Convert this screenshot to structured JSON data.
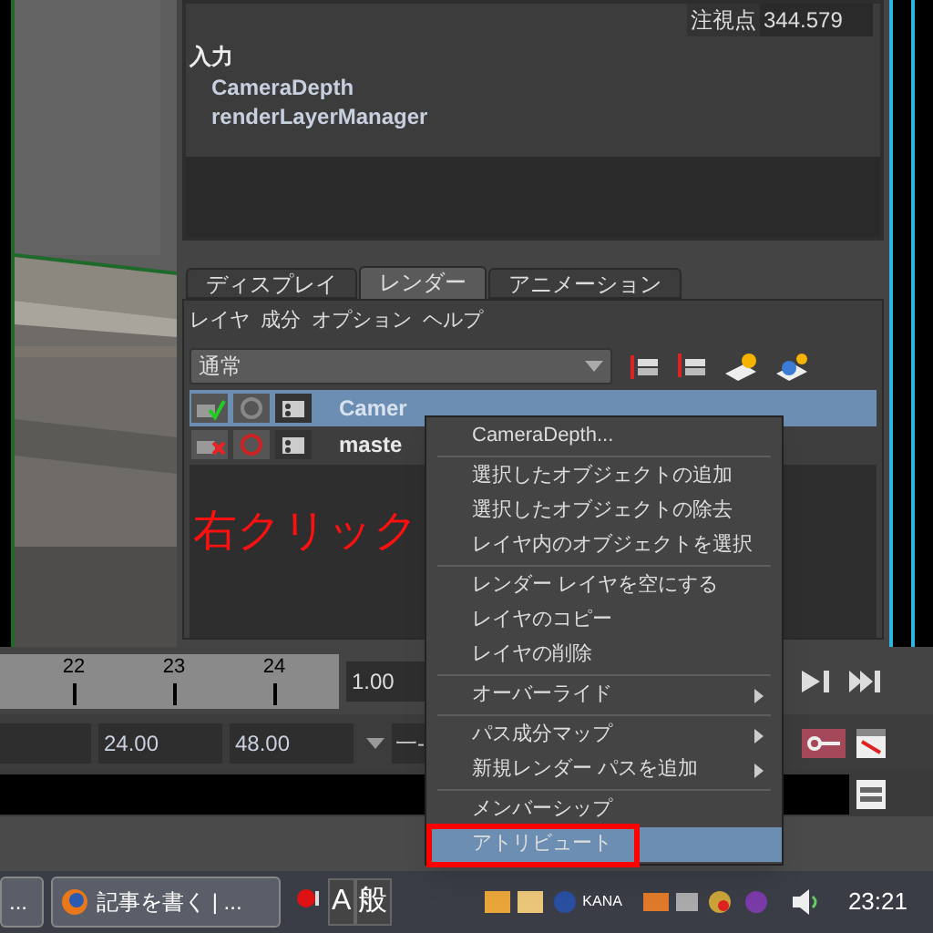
{
  "channel_box": {
    "look_at_label": "注視点",
    "look_at_value": "344.579",
    "inputs_heading": "入力",
    "inputs": [
      "CameraDepth",
      "renderLayerManager"
    ]
  },
  "tabs": [
    {
      "label": "ディスプレイ",
      "selected": false
    },
    {
      "label": "レンダー",
      "selected": true
    },
    {
      "label": "アニメーション",
      "selected": false
    }
  ],
  "layer_menu": [
    "レイヤ",
    "成分",
    "オプション",
    "ヘルプ"
  ],
  "blend_mode": "通常",
  "layers": [
    {
      "name": "Camer",
      "selected": true,
      "renderable": true
    },
    {
      "name": "maste",
      "selected": false,
      "renderable": false
    }
  ],
  "timeline": {
    "ticks": [
      "22",
      "23",
      "24"
    ],
    "current": "1.00"
  },
  "range": {
    "values": [
      "24.00",
      "48.00"
    ],
    "option": "一-"
  },
  "context_menu": [
    [
      {
        "label": "CameraDepth...",
        "submenu": false,
        "selected": false,
        "marked": false
      }
    ],
    [
      {
        "label": "選択したオブジェクトの追加",
        "submenu": false,
        "selected": false,
        "marked": false
      },
      {
        "label": "選択したオブジェクトの除去",
        "submenu": false,
        "selected": false,
        "marked": false
      },
      {
        "label": "レイヤ内のオブジェクトを選択",
        "submenu": false,
        "selected": false,
        "marked": false
      }
    ],
    [
      {
        "label": "レンダー レイヤを空にする",
        "submenu": false,
        "selected": false,
        "marked": false
      },
      {
        "label": "レイヤのコピー",
        "submenu": false,
        "selected": false,
        "marked": false
      },
      {
        "label": "レイヤの削除",
        "submenu": false,
        "selected": false,
        "marked": false
      }
    ],
    [
      {
        "label": "オーバーライド",
        "submenu": true,
        "selected": false,
        "marked": false
      }
    ],
    [
      {
        "label": "パス成分マップ",
        "submenu": true,
        "selected": false,
        "marked": false
      },
      {
        "label": "新規レンダー パスを追加",
        "submenu": true,
        "selected": false,
        "marked": false
      }
    ],
    [
      {
        "label": "メンバーシップ",
        "submenu": false,
        "selected": false,
        "marked": false
      },
      {
        "label": "アトリビュート",
        "submenu": false,
        "selected": true,
        "marked": true
      }
    ]
  ],
  "annotation": "右クリック",
  "taskbar": {
    "buttons": [
      "...",
      "記事を書く | ..."
    ],
    "ime": [
      "A",
      "般"
    ],
    "input_mode": "KANA",
    "clock": "23:21"
  }
}
